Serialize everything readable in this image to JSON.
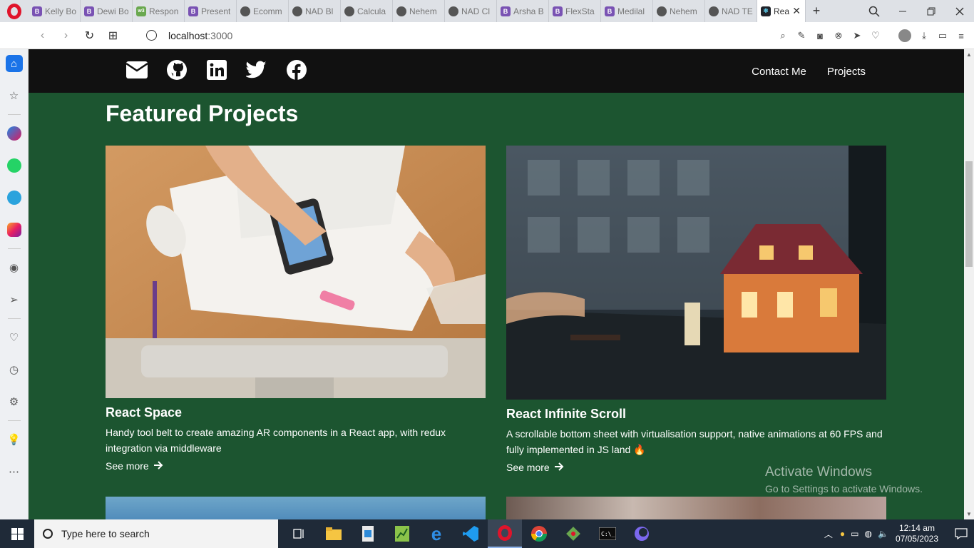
{
  "browser": {
    "tabs": [
      {
        "title": "Kelly Bo",
        "icon_color": "#7952b3",
        "icon_letter": "B"
      },
      {
        "title": "Dewi Bo",
        "icon_color": "#7952b3",
        "icon_letter": "B"
      },
      {
        "title": "Respon",
        "icon_color": "#6aa84f",
        "icon_letter": "w3"
      },
      {
        "title": "Present",
        "icon_color": "#7952b3",
        "icon_letter": "B"
      },
      {
        "title": "Ecomm",
        "icon_color": "#555555",
        "icon_letter": ""
      },
      {
        "title": "NAD Bl",
        "icon_color": "#555555",
        "icon_letter": ""
      },
      {
        "title": "Calcula",
        "icon_color": "#555555",
        "icon_letter": ""
      },
      {
        "title": "Nehem",
        "icon_color": "#555555",
        "icon_letter": ""
      },
      {
        "title": "NAD Cl",
        "icon_color": "#555555",
        "icon_letter": ""
      },
      {
        "title": "Arsha B",
        "icon_color": "#7952b3",
        "icon_letter": "B"
      },
      {
        "title": "FlexSta",
        "icon_color": "#7952b3",
        "icon_letter": "B"
      },
      {
        "title": "Medilal",
        "icon_color": "#7952b3",
        "icon_letter": "B"
      },
      {
        "title": "Nehem",
        "icon_color": "#555555",
        "icon_letter": ""
      },
      {
        "title": "NAD TE",
        "icon_color": "#555555",
        "icon_letter": ""
      }
    ],
    "active_tab": {
      "title": "Rea",
      "close": "✕"
    },
    "new_tab": "+",
    "url_host": "localhost",
    "url_port": ":3000"
  },
  "nav": {
    "links": [
      "Contact Me",
      "Projects"
    ]
  },
  "page": {
    "heading": "Featured Projects",
    "projects": [
      {
        "title": "React Space",
        "description": "Handy tool belt to create amazing AR components in a React app, with redux integration via middleware",
        "link": "See more"
      },
      {
        "title": "React Infinite Scroll",
        "description": "A scrollable bottom sheet with virtualisation support, native animations at 60 FPS and fully implemented in JS land 🔥",
        "link": "See more"
      }
    ]
  },
  "watermark": {
    "line1": "Activate Windows",
    "line2": "Go to Settings to activate Windows."
  },
  "taskbar": {
    "search_placeholder": "Type here to search",
    "time": "12:14 am",
    "date": "07/05/2023"
  },
  "colors": {
    "page_bg": "#1c5530",
    "nav_bg": "#111111",
    "taskbar_bg": "#1f2a38"
  }
}
